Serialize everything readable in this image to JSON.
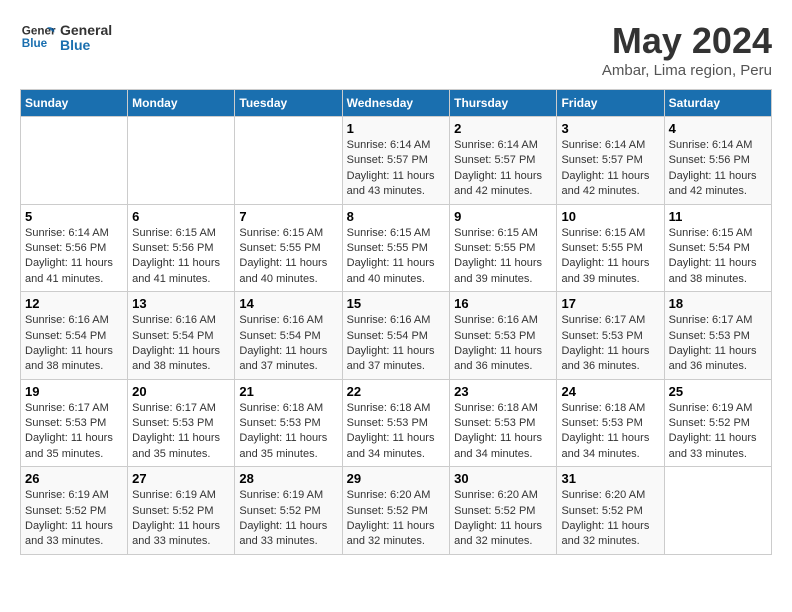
{
  "logo": {
    "line1": "General",
    "line2": "Blue"
  },
  "title": "May 2024",
  "subtitle": "Ambar, Lima region, Peru",
  "headers": [
    "Sunday",
    "Monday",
    "Tuesday",
    "Wednesday",
    "Thursday",
    "Friday",
    "Saturday"
  ],
  "weeks": [
    [
      {
        "day": "",
        "content": ""
      },
      {
        "day": "",
        "content": ""
      },
      {
        "day": "",
        "content": ""
      },
      {
        "day": "1",
        "content": "Sunrise: 6:14 AM\nSunset: 5:57 PM\nDaylight: 11 hours and 43 minutes."
      },
      {
        "day": "2",
        "content": "Sunrise: 6:14 AM\nSunset: 5:57 PM\nDaylight: 11 hours and 42 minutes."
      },
      {
        "day": "3",
        "content": "Sunrise: 6:14 AM\nSunset: 5:57 PM\nDaylight: 11 hours and 42 minutes."
      },
      {
        "day": "4",
        "content": "Sunrise: 6:14 AM\nSunset: 5:56 PM\nDaylight: 11 hours and 42 minutes."
      }
    ],
    [
      {
        "day": "5",
        "content": "Sunrise: 6:14 AM\nSunset: 5:56 PM\nDaylight: 11 hours and 41 minutes."
      },
      {
        "day": "6",
        "content": "Sunrise: 6:15 AM\nSunset: 5:56 PM\nDaylight: 11 hours and 41 minutes."
      },
      {
        "day": "7",
        "content": "Sunrise: 6:15 AM\nSunset: 5:55 PM\nDaylight: 11 hours and 40 minutes."
      },
      {
        "day": "8",
        "content": "Sunrise: 6:15 AM\nSunset: 5:55 PM\nDaylight: 11 hours and 40 minutes."
      },
      {
        "day": "9",
        "content": "Sunrise: 6:15 AM\nSunset: 5:55 PM\nDaylight: 11 hours and 39 minutes."
      },
      {
        "day": "10",
        "content": "Sunrise: 6:15 AM\nSunset: 5:55 PM\nDaylight: 11 hours and 39 minutes."
      },
      {
        "day": "11",
        "content": "Sunrise: 6:15 AM\nSunset: 5:54 PM\nDaylight: 11 hours and 38 minutes."
      }
    ],
    [
      {
        "day": "12",
        "content": "Sunrise: 6:16 AM\nSunset: 5:54 PM\nDaylight: 11 hours and 38 minutes."
      },
      {
        "day": "13",
        "content": "Sunrise: 6:16 AM\nSunset: 5:54 PM\nDaylight: 11 hours and 38 minutes."
      },
      {
        "day": "14",
        "content": "Sunrise: 6:16 AM\nSunset: 5:54 PM\nDaylight: 11 hours and 37 minutes."
      },
      {
        "day": "15",
        "content": "Sunrise: 6:16 AM\nSunset: 5:54 PM\nDaylight: 11 hours and 37 minutes."
      },
      {
        "day": "16",
        "content": "Sunrise: 6:16 AM\nSunset: 5:53 PM\nDaylight: 11 hours and 36 minutes."
      },
      {
        "day": "17",
        "content": "Sunrise: 6:17 AM\nSunset: 5:53 PM\nDaylight: 11 hours and 36 minutes."
      },
      {
        "day": "18",
        "content": "Sunrise: 6:17 AM\nSunset: 5:53 PM\nDaylight: 11 hours and 36 minutes."
      }
    ],
    [
      {
        "day": "19",
        "content": "Sunrise: 6:17 AM\nSunset: 5:53 PM\nDaylight: 11 hours and 35 minutes."
      },
      {
        "day": "20",
        "content": "Sunrise: 6:17 AM\nSunset: 5:53 PM\nDaylight: 11 hours and 35 minutes."
      },
      {
        "day": "21",
        "content": "Sunrise: 6:18 AM\nSunset: 5:53 PM\nDaylight: 11 hours and 35 minutes."
      },
      {
        "day": "22",
        "content": "Sunrise: 6:18 AM\nSunset: 5:53 PM\nDaylight: 11 hours and 34 minutes."
      },
      {
        "day": "23",
        "content": "Sunrise: 6:18 AM\nSunset: 5:53 PM\nDaylight: 11 hours and 34 minutes."
      },
      {
        "day": "24",
        "content": "Sunrise: 6:18 AM\nSunset: 5:53 PM\nDaylight: 11 hours and 34 minutes."
      },
      {
        "day": "25",
        "content": "Sunrise: 6:19 AM\nSunset: 5:52 PM\nDaylight: 11 hours and 33 minutes."
      }
    ],
    [
      {
        "day": "26",
        "content": "Sunrise: 6:19 AM\nSunset: 5:52 PM\nDaylight: 11 hours and 33 minutes."
      },
      {
        "day": "27",
        "content": "Sunrise: 6:19 AM\nSunset: 5:52 PM\nDaylight: 11 hours and 33 minutes."
      },
      {
        "day": "28",
        "content": "Sunrise: 6:19 AM\nSunset: 5:52 PM\nDaylight: 11 hours and 33 minutes."
      },
      {
        "day": "29",
        "content": "Sunrise: 6:20 AM\nSunset: 5:52 PM\nDaylight: 11 hours and 32 minutes."
      },
      {
        "day": "30",
        "content": "Sunrise: 6:20 AM\nSunset: 5:52 PM\nDaylight: 11 hours and 32 minutes."
      },
      {
        "day": "31",
        "content": "Sunrise: 6:20 AM\nSunset: 5:52 PM\nDaylight: 11 hours and 32 minutes."
      },
      {
        "day": "",
        "content": ""
      }
    ]
  ]
}
